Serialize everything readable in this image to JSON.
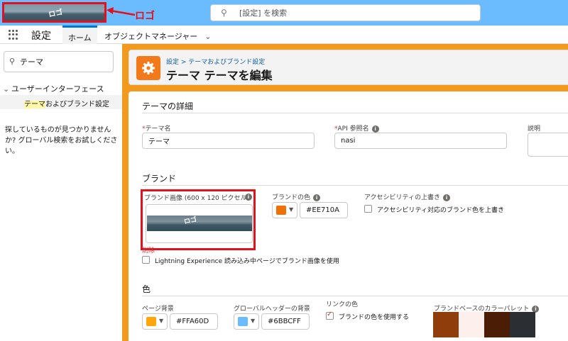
{
  "header": {
    "logo_text": "ロゴ",
    "annotation": "ロゴ",
    "search_placeholder": "[設定] を検索"
  },
  "nav": {
    "app_name": "設定",
    "tabs": [
      {
        "label": "ホーム"
      },
      {
        "label": "オブジェクトマネージャー"
      }
    ]
  },
  "sidebar": {
    "quickfind_value": "テーマ",
    "tree_parent": "ユーザーインターフェース",
    "tree_child_highlight": "テーマ",
    "tree_child_rest": "およびブランド設定",
    "notfound": "探しているものが見つかりませんか? グローバル検索をお試しください。"
  },
  "page": {
    "breadcrumb": "設定 > テーマおよびブランド設定",
    "title": "テーマ テーマを編集"
  },
  "details": {
    "section_title": "テーマの詳細",
    "theme_name_label": "テーマ名",
    "theme_name_value": "テーマ",
    "api_name_label": "API 参照名",
    "api_name_value": "nasi",
    "description_label": "説明"
  },
  "brand": {
    "section_title": "ブランド",
    "image_label": "ブランド画像 (600 x 120 ピクセル)",
    "image_logo_text": "ロゴ",
    "delete_label": "削除",
    "use_image_label": "Lightning Experience 読み込み中ページでブランド画像を使用",
    "color_label": "ブランドの色",
    "color_value": "#EE710A",
    "color_hex": "#ee710a",
    "accessibility_label": "アクセシビリティの上書き",
    "accessibility_checkbox": "アクセシビリティ対応のブランド色を上書き"
  },
  "colors": {
    "section_title": "色",
    "page_bg_label": "ページ背景",
    "page_bg_value": "#FFA60D",
    "page_bg_hex": "#ffa60d",
    "global_header_label": "グローバルヘッダーの背景",
    "global_header_value": "#6BBCFF",
    "global_header_hex": "#6bbcff",
    "link_color_label": "リンクの色",
    "link_color_checkbox": "ブランドの色を使用する",
    "palette_label": "ブランドベースのカラーパレット",
    "palette": [
      "#8f3d0b",
      "#fdf0ec",
      "#4a1d04",
      "#2b2f33"
    ]
  }
}
